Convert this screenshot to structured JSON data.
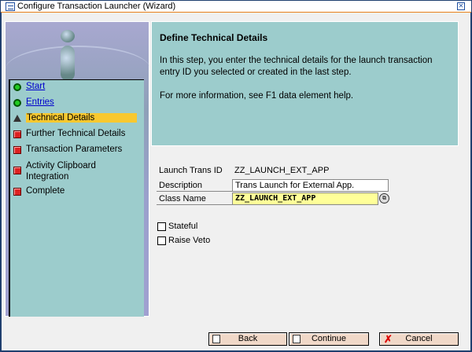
{
  "window": {
    "title": "Configure Transaction Launcher (Wizard)",
    "close_icon": "close-icon"
  },
  "steps": [
    {
      "label": "Start",
      "status": "done",
      "link": true
    },
    {
      "label": "Entries",
      "status": "done",
      "link": true
    },
    {
      "label": "Technical Details",
      "status": "current",
      "link": false
    },
    {
      "label": "Further Technical Details",
      "status": "pending",
      "link": false
    },
    {
      "label": "Transaction Parameters",
      "status": "pending",
      "link": false
    },
    {
      "label": "Activity Clipboard Integration",
      "status": "pending",
      "link": false
    },
    {
      "label": "Complete",
      "status": "pending",
      "link": false
    }
  ],
  "header": {
    "title": "Define Technical Details",
    "text1": "In this step, you enter the technical details for the launch transaction entry ID you selected or created in the last step.",
    "text2": "For more information, see F1 data element help."
  },
  "form": {
    "launch_id_label": "Launch Trans ID",
    "launch_id_value": "ZZ_LAUNCH_EXT_APP",
    "description_label": "Description",
    "description_value": "Trans Launch for External App.",
    "class_label": "Class Name",
    "class_value": "ZZ_LAUNCH_EXT_APP",
    "stateful_label": "Stateful",
    "stateful_checked": false,
    "veto_label": "Raise Veto",
    "veto_checked": false
  },
  "buttons": {
    "back": "Back",
    "continue": "Continue",
    "cancel": "Cancel"
  },
  "colors": {
    "panel": "#9ccccc",
    "highlight": "#f8c830",
    "button": "#f0d8c8",
    "input_required": "#ffff99"
  }
}
